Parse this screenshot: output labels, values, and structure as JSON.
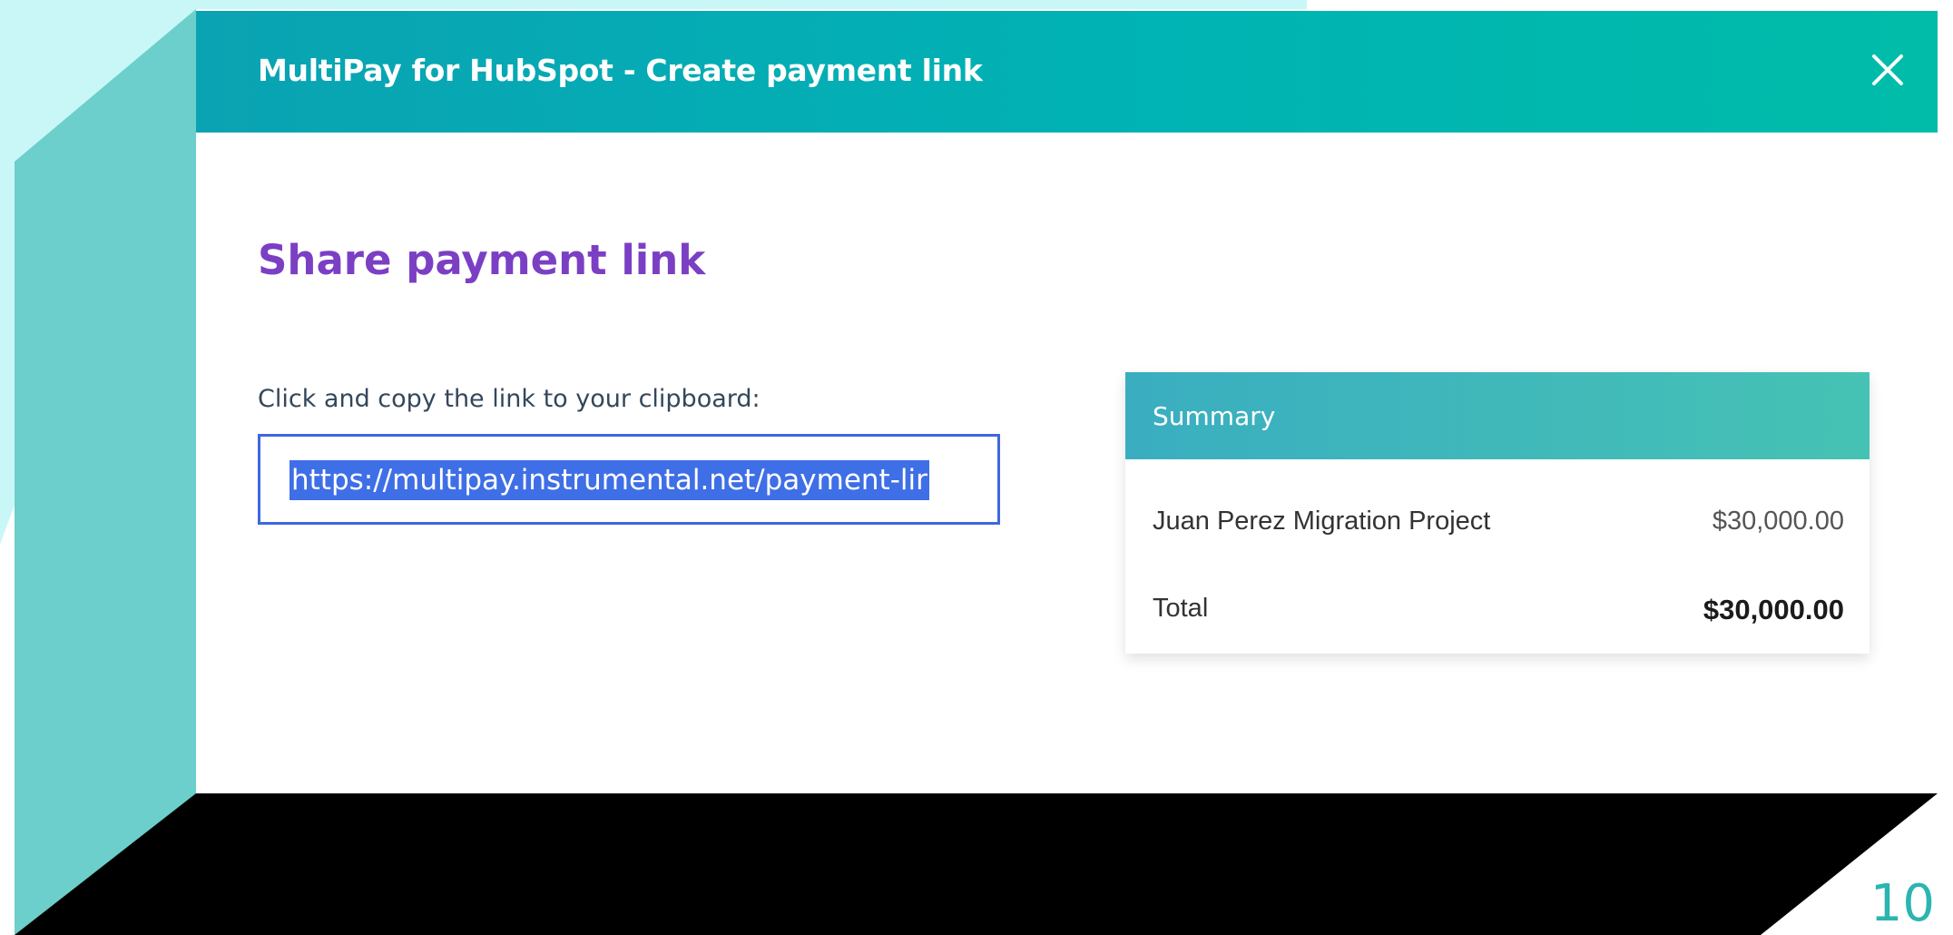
{
  "modal": {
    "title": "MultiPay for HubSpot - Create payment link",
    "close_icon": "close-icon"
  },
  "share": {
    "heading": "Share payment link",
    "instruction": "Click and copy the link to your clipboard:",
    "link_value": "https://multipay.instrumental.net/payment-lir"
  },
  "summary": {
    "title": "Summary",
    "items": [
      {
        "label": "Juan Perez Migration Project",
        "amount": "$30,000.00"
      }
    ],
    "total": {
      "label": "Total",
      "amount": "$30,000.00"
    }
  },
  "slide": {
    "page_number": "10"
  },
  "colors": {
    "header_gradient_start": "#0aa3b3",
    "header_gradient_end": "#00bca8",
    "heading_purple": "#7b3fc4",
    "link_border": "#3f67e0",
    "selection_blue": "#3f6fe6",
    "decor_light_cyan": "#c9f7f7",
    "decor_teal": "#6ccfcb",
    "decor_black": "#000000"
  }
}
